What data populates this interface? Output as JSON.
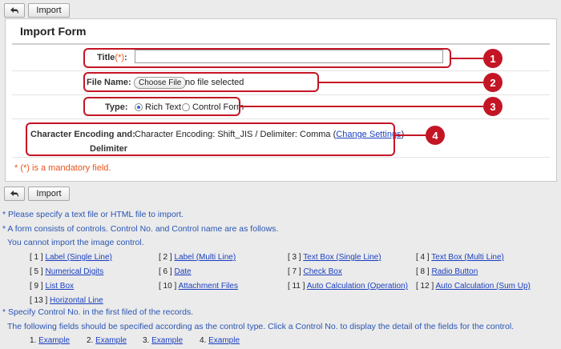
{
  "toolbar": {
    "back_icon": "back-arrow-icon",
    "import_label": "Import"
  },
  "form": {
    "title": "Import Form",
    "fields": {
      "title": {
        "label": "Title",
        "req": "(*)",
        "colon": ":",
        "value": ""
      },
      "file": {
        "label": "File Name:",
        "button": "Choose File",
        "status": "no file selected"
      },
      "type": {
        "label": "Type:",
        "options": [
          "Rich Text",
          "Control Form"
        ],
        "selected": "Rich Text"
      },
      "encoding": {
        "label_line1": "Character Encoding and:",
        "label_line2": "Delimiter",
        "value_text": "Character Encoding: Shift_JIS / Delimiter: Comma (",
        "link": "Change Settings",
        "close": ")"
      }
    },
    "mandatory_note": "* (*) is a mandatory field."
  },
  "annotations": [
    "1",
    "2",
    "3",
    "4"
  ],
  "notes": {
    "n1": "* Please specify a text file or HTML file to import.",
    "n2": "* A form consists of controls. Control No. and Control name are as follows.",
    "n3": "You cannot import the image control.",
    "n4": "* Specify Control No. in the first filed of the records.",
    "n5": "The following fields should be specified according as the control type. Click a Control No. to display the detail of the fields for the control."
  },
  "controls": [
    {
      "no": "[ 1 ]",
      "name": "Label (Single Line)"
    },
    {
      "no": "[ 2 ]",
      "name": "Label (Multi Line)"
    },
    {
      "no": "[ 3 ]",
      "name": "Text Box (Single Line)"
    },
    {
      "no": "[ 4 ]",
      "name": "Text Box (Multi Line)"
    },
    {
      "no": "[ 5 ]",
      "name": "Numerical Digits"
    },
    {
      "no": "[ 6 ]",
      "name": "Date"
    },
    {
      "no": "[ 7 ]",
      "name": "Check Box"
    },
    {
      "no": "[ 8 ]",
      "name": "Radio Button"
    },
    {
      "no": "[ 9 ]",
      "name": "List Box"
    },
    {
      "no": "[ 10 ]",
      "name": "Attachment Files"
    },
    {
      "no": "[ 11 ]",
      "name": "Auto Calculation (Operation)"
    },
    {
      "no": "[ 12 ]",
      "name": "Auto Calculation (Sum Up)"
    },
    {
      "no": "[ 13 ]",
      "name": "Horizontal Line"
    }
  ],
  "examples": [
    {
      "no": "1.",
      "link": "Example"
    },
    {
      "no": "2.",
      "link": "Example"
    },
    {
      "no": "3.",
      "link": "Example"
    },
    {
      "no": "4.",
      "link": "Example"
    }
  ]
}
